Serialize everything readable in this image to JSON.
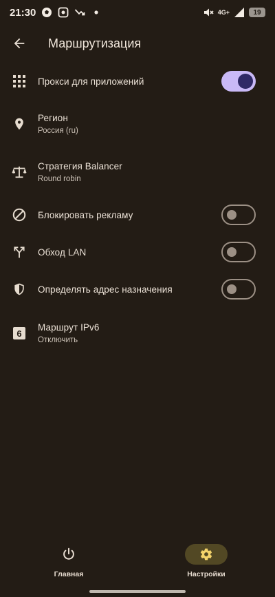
{
  "status_bar": {
    "time": "21:30",
    "network_type": "4G+",
    "battery_level": "19"
  },
  "app_bar": {
    "title": "Маршрутизация"
  },
  "settings": {
    "app_proxy": {
      "label": "Прокси для приложений",
      "enabled": true
    },
    "region": {
      "label": "Регион",
      "value": "Россия (ru)"
    },
    "balancer": {
      "label": "Стратегия Balancer",
      "value": "Round robin"
    },
    "block_ads": {
      "label": "Блокировать рекламу",
      "enabled": false
    },
    "bypass_lan": {
      "label": "Обход LAN",
      "enabled": false
    },
    "detect_destination": {
      "label": "Определять адрес назначения",
      "enabled": false
    },
    "ipv6_route": {
      "label": "Маршрут IPv6",
      "value": "Отключить"
    }
  },
  "bottom_nav": {
    "home_label": "Главная",
    "settings_label": "Настройки",
    "active": "settings"
  },
  "colors": {
    "background": "#231c15",
    "switch_on_track": "#c9b9f6",
    "switch_on_knob": "#2f2966",
    "nav_active_pill": "#524824",
    "nav_active_icon": "#f3d36b"
  },
  "icons": {
    "back": "arrow-left-icon",
    "app_proxy": "apps-grid-icon",
    "region": "location-pin-icon",
    "balancer": "scale-icon",
    "block_ads": "block-icon",
    "bypass_lan": "fork-arrows-icon",
    "detect_destination": "shield-icon",
    "ipv6_route": "six-badge-icon",
    "home": "power-icon",
    "settings": "gear-icon"
  }
}
